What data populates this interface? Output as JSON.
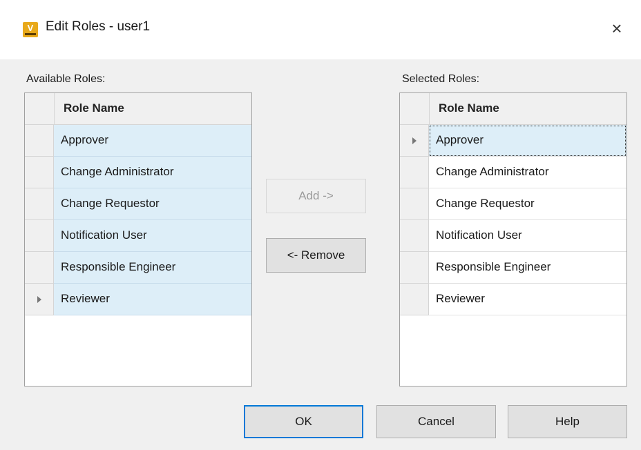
{
  "window": {
    "title": "Edit Roles - user1",
    "close_glyph": "×",
    "icon": "vault-app-icon"
  },
  "available": {
    "label": "Available Roles:",
    "column_header": "Role Name",
    "rows": [
      "Approver",
      "Change Administrator",
      "Change Requestor",
      "Notification User",
      "Responsible Engineer",
      "Reviewer"
    ],
    "current_row_index": 5
  },
  "selected": {
    "label": "Selected Roles:",
    "column_header": "Role Name",
    "rows": [
      "Approver",
      "Change Administrator",
      "Change Requestor",
      "Notification User",
      "Responsible Engineer",
      "Reviewer"
    ],
    "current_row_index": 0
  },
  "buttons": {
    "add": "Add ->",
    "remove": "<- Remove",
    "ok": "OK",
    "cancel": "Cancel",
    "help": "Help"
  },
  "colors": {
    "selection": "#ddeef8",
    "default_button_border": "#0078d7"
  }
}
